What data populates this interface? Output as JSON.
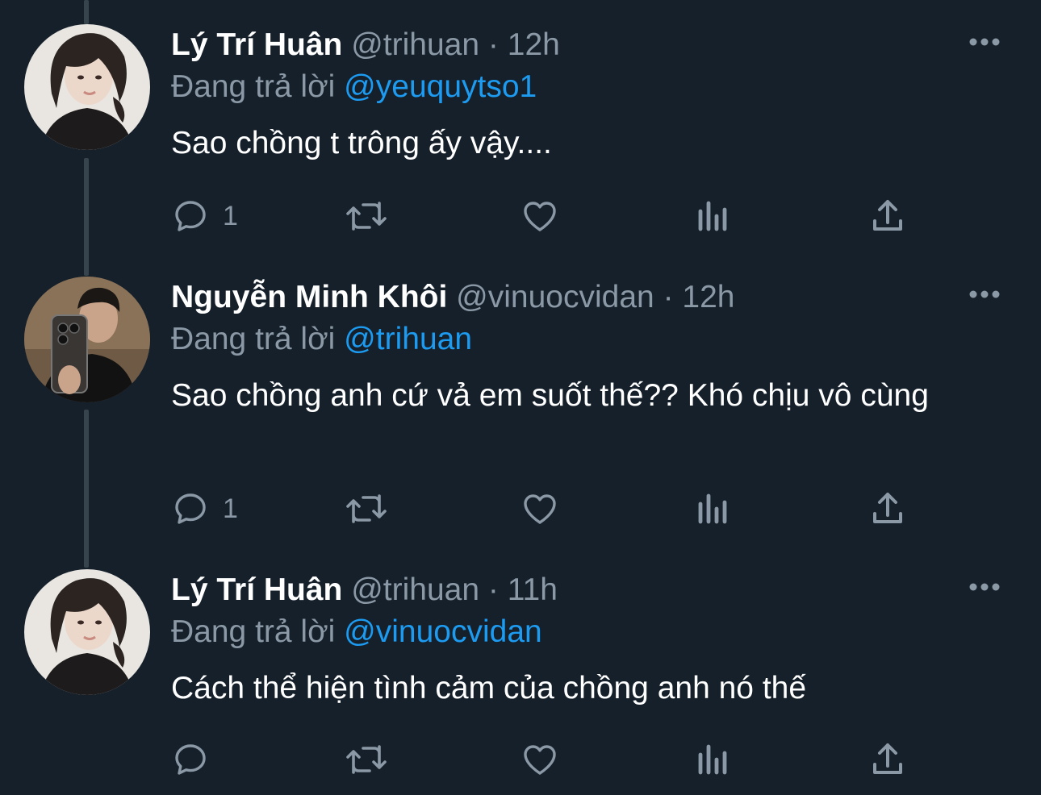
{
  "colors": {
    "background": "#15202b",
    "primary_text": "#ffffff",
    "secondary_text": "#8b98a5",
    "link": "#1d9bf0",
    "thread_line": "#38444d"
  },
  "reply_prefix": "Đang trả lời",
  "separator": "·",
  "tweets": [
    {
      "name": "Lý Trí Huân",
      "handle": "@trihuan",
      "time": "12h",
      "reply_to": "@yeuquytso1",
      "text": "Sao chồng t trông ấy vậy....",
      "reply_count": "1",
      "avatar_icon": "avatar-photo"
    },
    {
      "name": "Nguyễn Minh Khôi",
      "handle": "@vinuocvidan",
      "time": "12h",
      "reply_to": "@trihuan",
      "text": "Sao chồng anh cứ vả em suốt thế?? Khó chịu vô cùng",
      "reply_count": "1",
      "avatar_icon": "avatar-photo"
    },
    {
      "name": "Lý Trí Huân",
      "handle": "@trihuan",
      "time": "11h",
      "reply_to": "@vinuocvidan",
      "text": "Cách thể hiện tình cảm của chồng anh nó thế",
      "reply_count": "",
      "avatar_icon": "avatar-photo"
    }
  ],
  "action_icons": [
    "reply-icon",
    "retweet-icon",
    "like-icon",
    "analytics-icon",
    "share-icon"
  ],
  "more_icon": "more-options-icon"
}
